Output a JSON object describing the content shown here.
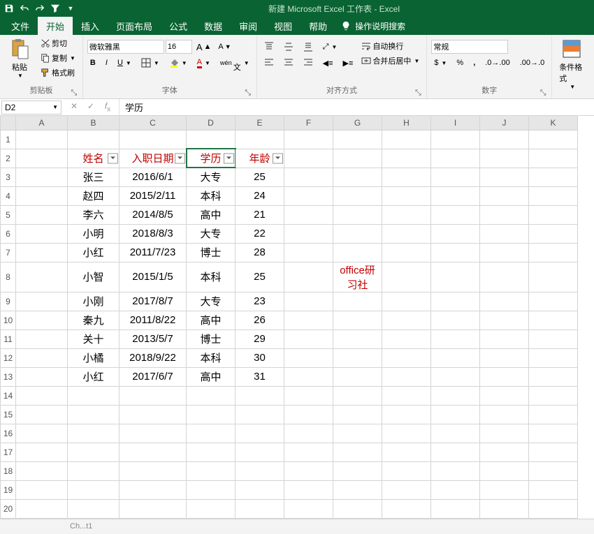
{
  "title": "新建 Microsoft Excel 工作表 - Excel",
  "tabs": {
    "file": "文件",
    "home": "开始",
    "insert": "插入",
    "layout": "页面布局",
    "formulas": "公式",
    "data": "数据",
    "review": "审阅",
    "view": "视图",
    "help": "帮助",
    "tellme": "操作说明搜索"
  },
  "ribbon": {
    "clipboard": {
      "label": "剪贴板",
      "paste": "粘贴",
      "cut": "剪切",
      "copy": "复制",
      "format_painter": "格式刷"
    },
    "font": {
      "label": "字体",
      "name": "微软雅黑",
      "size": "16"
    },
    "alignment": {
      "label": "对齐方式",
      "wrap": "自动换行",
      "merge": "合并后居中"
    },
    "number": {
      "label": "数字",
      "format": "常规"
    },
    "styles": {
      "cond_format": "条件格式"
    }
  },
  "namebox": "D2",
  "formula_value": "学历",
  "columns": [
    "A",
    "B",
    "C",
    "D",
    "E",
    "F",
    "G",
    "H",
    "I",
    "J",
    "K"
  ],
  "headers": {
    "B": "姓名",
    "C": "入职日期",
    "D": "学历",
    "E": "年龄"
  },
  "rows": [
    {
      "r": 3,
      "B": "张三",
      "C": "2016/6/1",
      "D": "大专",
      "E": "25"
    },
    {
      "r": 4,
      "B": "赵四",
      "C": "2015/2/11",
      "D": "本科",
      "E": "24"
    },
    {
      "r": 5,
      "B": "李六",
      "C": "2014/8/5",
      "D": "高中",
      "E": "21"
    },
    {
      "r": 6,
      "B": "小明",
      "C": "2018/8/3",
      "D": "大专",
      "E": "22"
    },
    {
      "r": 7,
      "B": "小红",
      "C": "2011/7/23",
      "D": "博士",
      "E": "28"
    },
    {
      "r": 8,
      "B": "小智",
      "C": "2015/1/5",
      "D": "本科",
      "E": "25"
    },
    {
      "r": 9,
      "B": "小刚",
      "C": "2017/8/7",
      "D": "大专",
      "E": "23"
    },
    {
      "r": 10,
      "B": "秦九",
      "C": "2011/8/22",
      "D": "高中",
      "E": "26"
    },
    {
      "r": 11,
      "B": "关十",
      "C": "2013/5/7",
      "D": "博士",
      "E": "29"
    },
    {
      "r": 12,
      "B": "小橘",
      "C": "2018/9/22",
      "D": "本科",
      "E": "30"
    },
    {
      "r": 13,
      "B": "小红",
      "C": "2017/6/7",
      "D": "高中",
      "E": "31"
    }
  ],
  "watermark": "office研习社",
  "sheet_tab_hint": "Ch...t1"
}
